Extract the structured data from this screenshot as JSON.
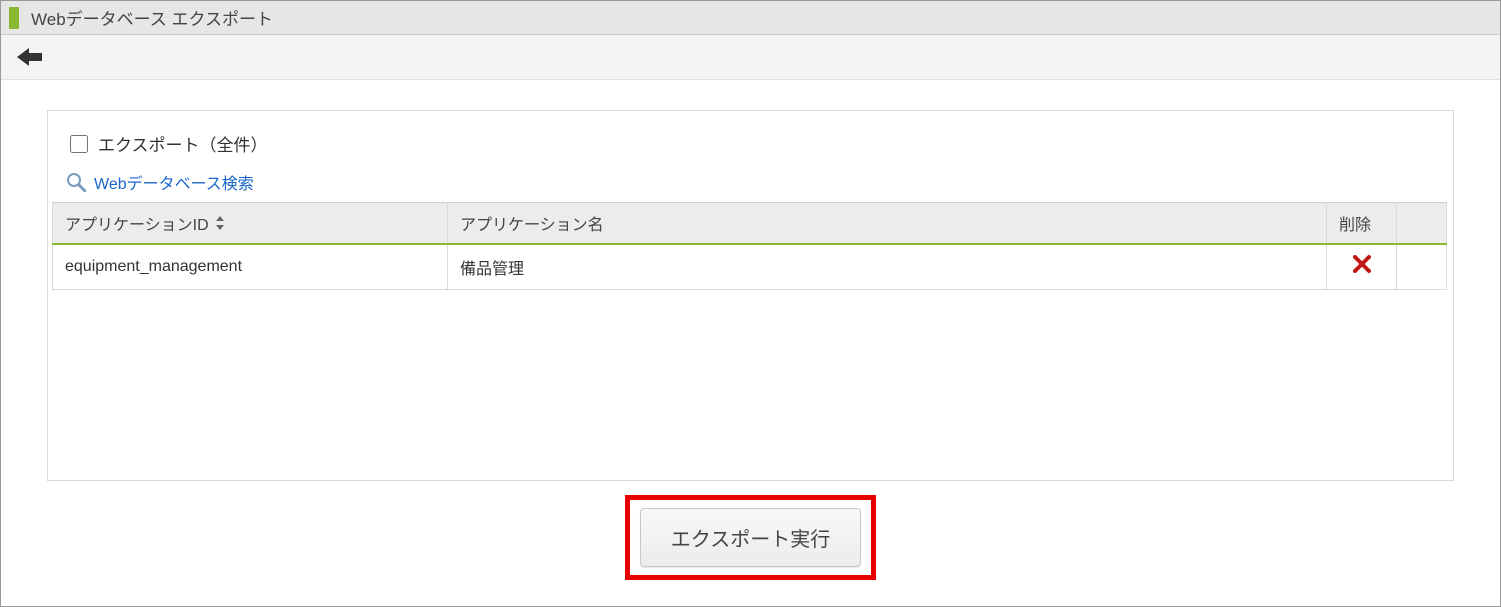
{
  "header": {
    "title": "Webデータベース エクスポート"
  },
  "export_all": {
    "label": "エクスポート（全件）",
    "checked": false
  },
  "search": {
    "link_label": "Webデータベース検索"
  },
  "table": {
    "columns": {
      "id": "アプリケーションID",
      "name": "アプリケーション名",
      "delete": "削除"
    },
    "rows": [
      {
        "id": "equipment_management",
        "name": "備品管理"
      }
    ]
  },
  "buttons": {
    "export_run": "エクスポート実行"
  }
}
